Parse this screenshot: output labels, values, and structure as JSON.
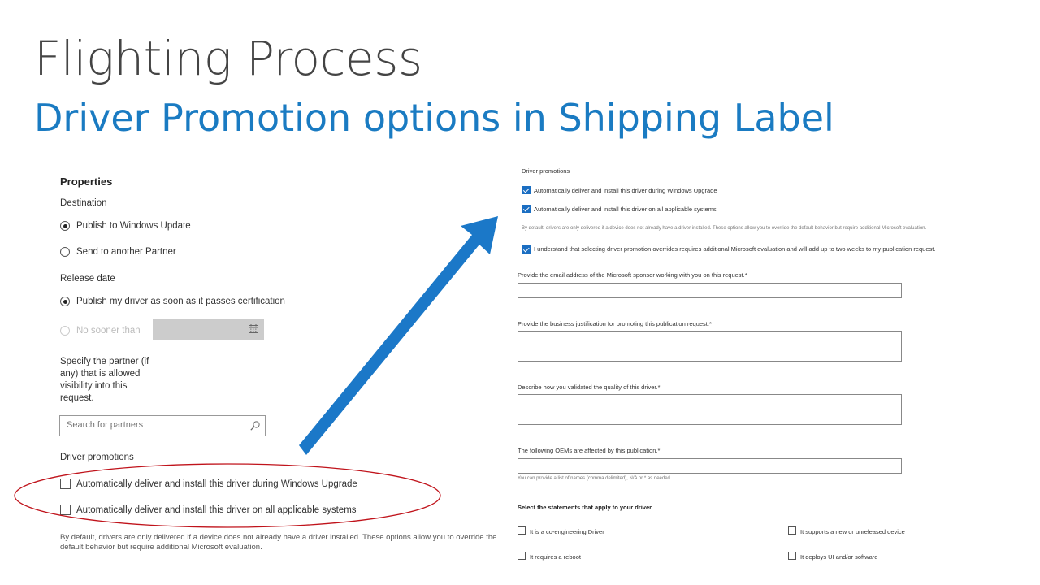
{
  "slide": {
    "title": "Flighting Process",
    "subtitle": "Driver Promotion options in Shipping Label"
  },
  "left_panel": {
    "heading": "Properties",
    "destination_label": "Destination",
    "destination_options": [
      "Publish to Windows Update",
      "Send to another Partner"
    ],
    "destination_selected": "Publish to Windows Update",
    "release_label": "Release date",
    "release_options": [
      "Publish my driver as soon as it passes certification",
      "No sooner than"
    ],
    "partner_label": "Specify the partner (if any) that is allowed visibility into this request.",
    "partner_search_placeholder": "Search for partners",
    "promotions_label": "Driver promotions",
    "promotion_options": [
      "Automatically deliver and install this driver during Windows Upgrade",
      "Automatically deliver and install this driver on all applicable systems"
    ],
    "promotion_note": "By default, drivers are only delivered if a device does not already have a driver installed. These options allow you to override the default behavior but require additional Microsoft evaluation."
  },
  "right_panel": {
    "promotions_label": "Driver promotions",
    "promotion_options": [
      "Automatically deliver and install this driver during Windows Upgrade",
      "Automatically deliver and install this driver on all applicable systems"
    ],
    "promotion_note": "By default, drivers are only delivered if a device does not already have a driver installed. These options allow you to override the default behavior but require additional Microsoft evaluation.",
    "acknowledge": "I understand that selecting driver promotion overrides requires additional Microsoft evaluation and will add up to two weeks to my publication request.",
    "sponsor_label": "Provide the email address of the Microsoft sponsor working with you on this request.*",
    "justification_label": "Provide the business justification for promoting this publication request.*",
    "validation_label": "Describe how you validated the quality of this driver.*",
    "oems_label": "The following OEMs are affected by this publication.*",
    "oems_hint": "You can provide a list of names (comma delimited), N/A or * as needed.",
    "statements_label": "Select the statements that apply to your driver",
    "statements": [
      "It is a co-engineering Driver",
      "It supports a new or unreleased device",
      "It requires a reboot",
      "It deploys UI and/or software"
    ]
  },
  "colors": {
    "accent": "#1a7bc2",
    "arrow": "#1b78c8",
    "highlight_ellipse": "#c0131b"
  }
}
